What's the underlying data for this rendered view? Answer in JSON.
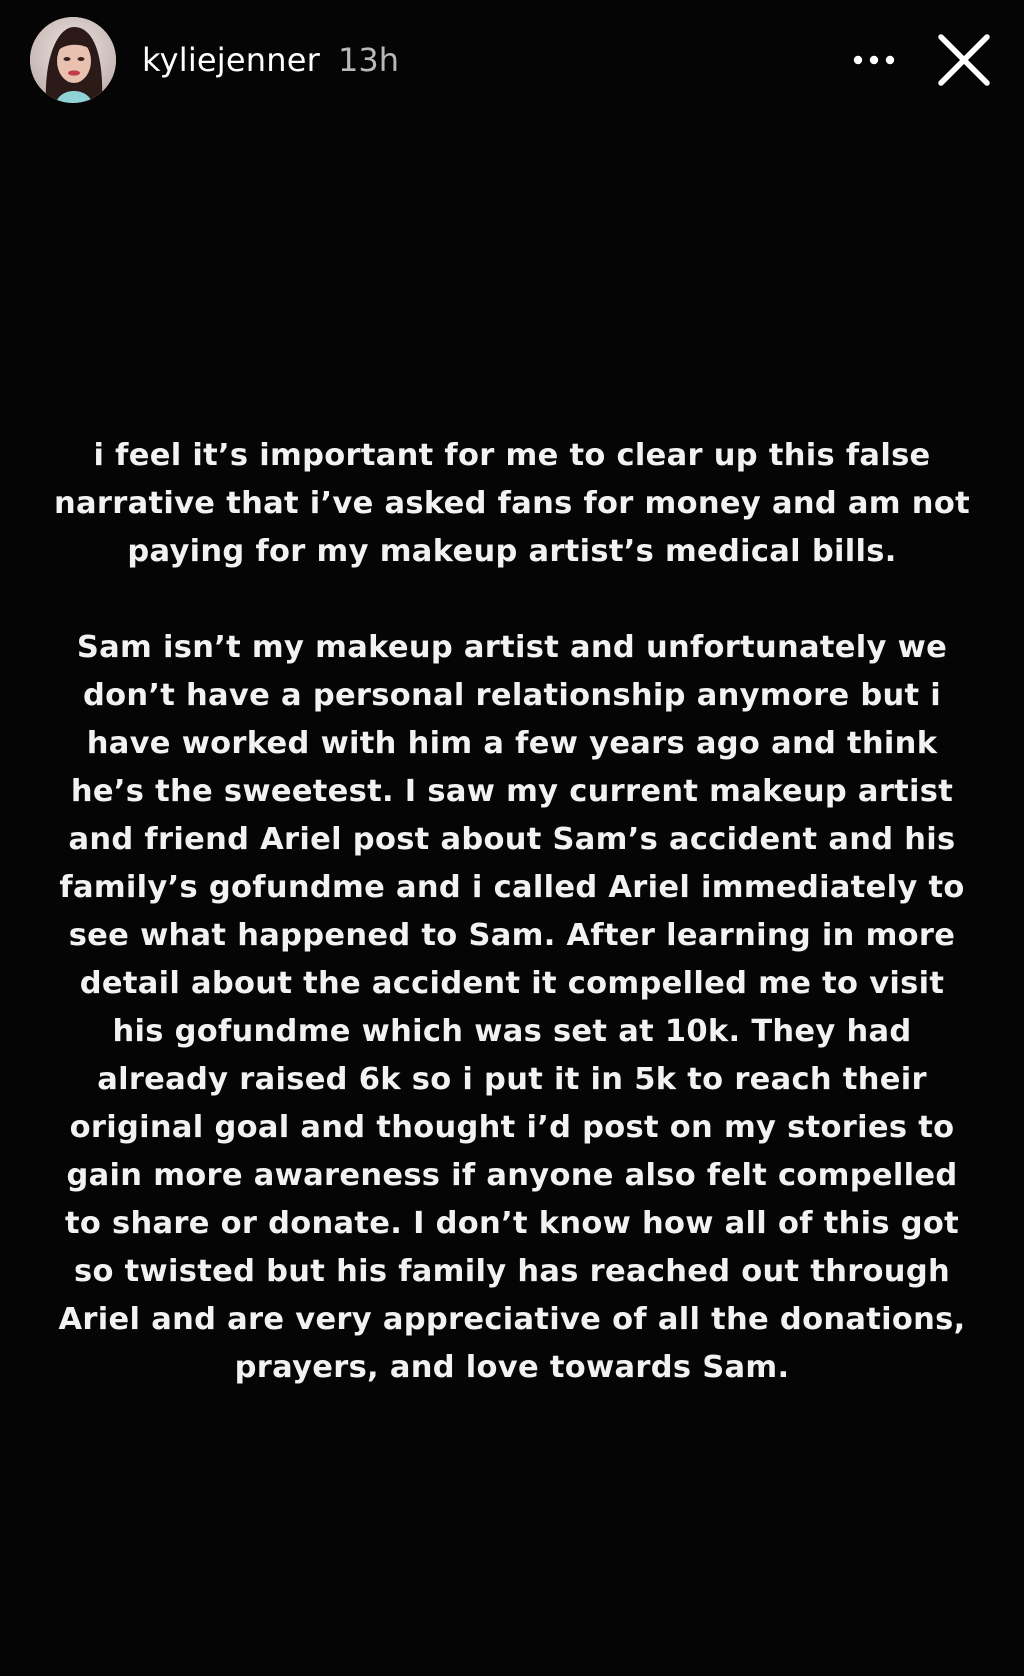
{
  "header": {
    "username": "kyliejenner",
    "timestamp": "13h",
    "avatar_icon": "profile-photo",
    "more_icon": "more-horizontal-icon",
    "close_icon": "close-icon"
  },
  "story": {
    "paragraph1": [
      "i feel it’s important for me to clear up this false",
      "narrative that i’ve asked fans for money and am not",
      "paying for my makeup artist’s medical bills."
    ],
    "paragraph2": [
      "Sam isn’t my makeup artist and unfortunately we",
      "don’t have a personal relationship anymore but i",
      "have worked with him a few years ago and think",
      "he’s the sweetest. I saw my current makeup artist",
      "and friend Ariel post about Sam’s accident and his",
      "family’s gofundme and i called Ariel immediately to",
      "see what happened to Sam. After learning in more",
      "detail about the accident it compelled me to visit",
      "his gofundme which was set at 10k. They had",
      "already raised 6k so i put it in 5k to reach their",
      "original goal and thought i’d post on my stories to",
      "gain more awareness if anyone also felt compelled",
      "to share or donate. I don’t know how all of this got",
      "so twisted but his family has reached out through",
      "Ariel and are very appreciative of all the donations,",
      "prayers, and love towards Sam."
    ]
  },
  "colors": {
    "background": "#050505",
    "text": "#f2f2f2",
    "timestamp": "#b9b9b9"
  }
}
